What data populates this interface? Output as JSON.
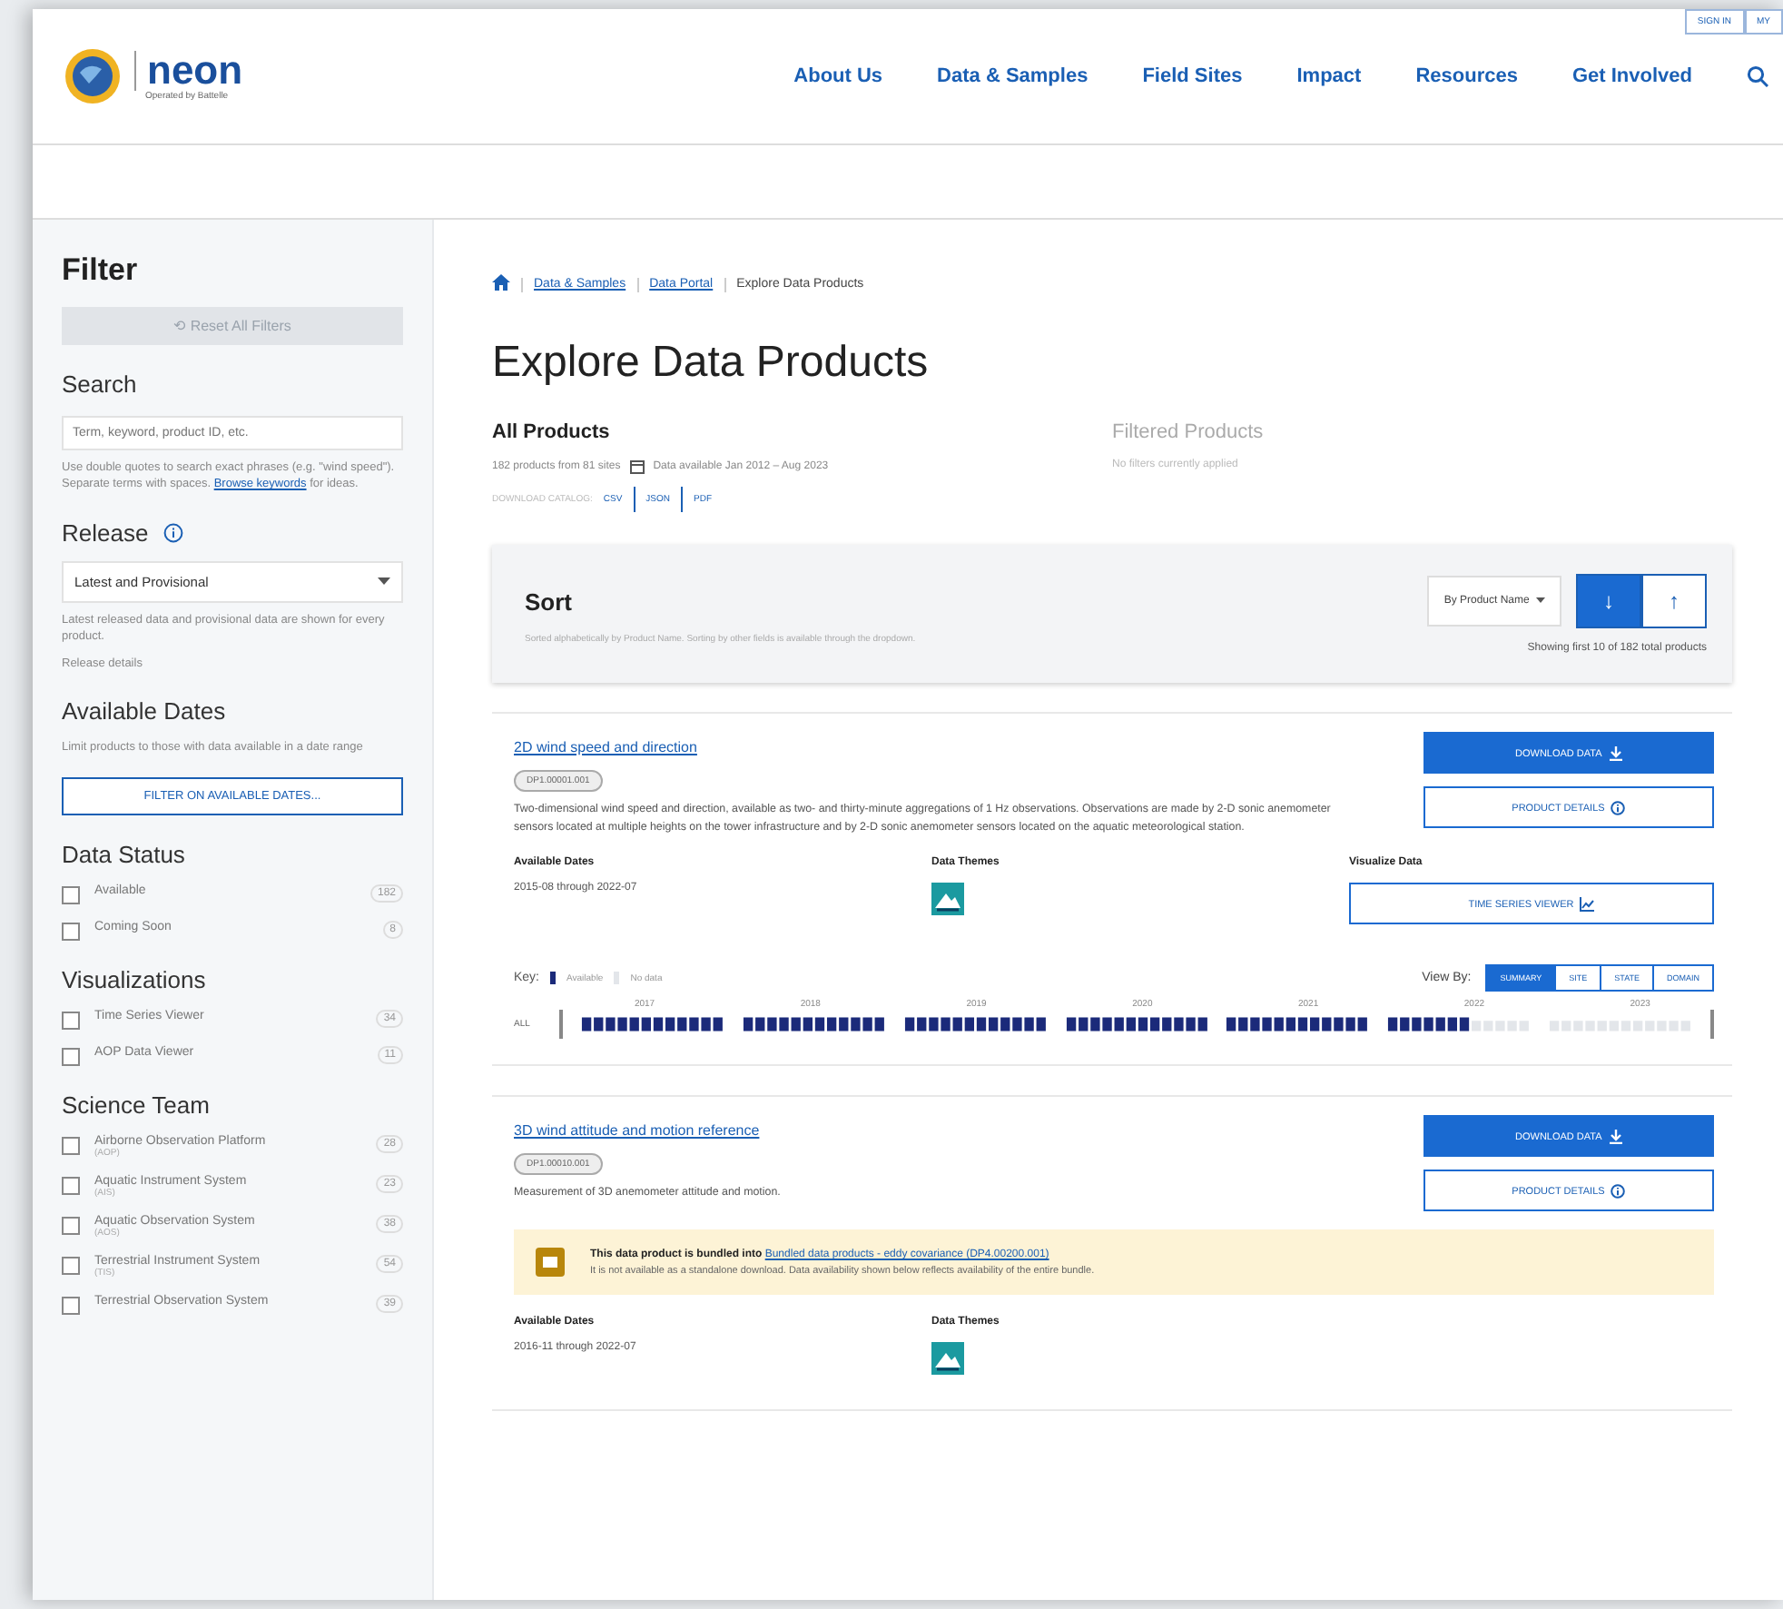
{
  "header": {
    "logo_text": "neon",
    "logo_subtitle": "Operated by Battelle",
    "nav": [
      "About Us",
      "Data & Samples",
      "Field Sites",
      "Impact",
      "Resources",
      "Get Involved"
    ],
    "top_links": [
      "SIGN IN",
      "MY"
    ]
  },
  "sidebar": {
    "title": "Filter",
    "reset_button": "⟲ Reset All Filters",
    "search": {
      "title": "Search",
      "placeholder": "Term, keyword, product ID, etc.",
      "help": "Use double quotes to search exact phrases (e.g. \"wind speed\"). Separate terms with spaces.",
      "help_link": "Browse keywords",
      "help_end": "for ideas."
    },
    "release": {
      "title": "Release",
      "value": "Latest and Provisional",
      "help": "Latest released data and provisional data are shown for every product.",
      "link": "Release details"
    },
    "dates": {
      "title": "Available Dates",
      "help": "Limit products to those with data available in a date range",
      "button": "FILTER ON AVAILABLE DATES..."
    },
    "groups": [
      {
        "title": "Data Status",
        "items": [
          {
            "label": "Available",
            "count": "182",
            "checked": false
          },
          {
            "label": "Coming Soon",
            "count": "8",
            "checked": false
          }
        ]
      },
      {
        "title": "Visualizations",
        "items": [
          {
            "label": "Time Series Viewer",
            "count": "34",
            "checked": false
          },
          {
            "label": "AOP Data Viewer",
            "count": "11",
            "checked": false
          }
        ]
      },
      {
        "title": "Science Team",
        "items": [
          {
            "label": "Airborne Observation Platform",
            "sub": "(AOP)",
            "count": "28",
            "checked": false
          },
          {
            "label": "Aquatic Instrument System",
            "sub": "(AIS)",
            "count": "23",
            "checked": false
          },
          {
            "label": "Aquatic Observation System",
            "sub": "(AOS)",
            "count": "38",
            "checked": false
          },
          {
            "label": "Terrestrial Instrument System",
            "sub": "(TIS)",
            "count": "54",
            "checked": false
          },
          {
            "label": "Terrestrial Observation System",
            "count": "39",
            "checked": false
          }
        ]
      }
    ]
  },
  "breadcrumb": [
    {
      "label": "Data & Samples",
      "kind": "link"
    },
    {
      "label": "Data Portal",
      "kind": "link"
    },
    {
      "label": "Explore Data Products",
      "kind": "current"
    }
  ],
  "title": "Explore Data Products",
  "all_products": {
    "title": "All Products",
    "count": "182 products from 81 sites",
    "dates": "Data available Jan 2012 – Aug 2023",
    "catalog_label": "DOWNLOAD CATALOG:",
    "formats": [
      "CSV",
      "JSON",
      "PDF"
    ]
  },
  "filtered_products": {
    "title": "Filtered Products",
    "note": "No filters currently applied"
  },
  "sort": {
    "title": "Sort",
    "note": "Sorted alphabetically by Product Name. Sorting by other fields is available through the dropdown.",
    "dropdown": "By Product Name",
    "directions": [
      {
        "label": "↓",
        "selected": true
      },
      {
        "label": "↑",
        "selected": false
      }
    ],
    "showing": "Showing first 10 of 182 total products"
  },
  "products": [
    {
      "name": "2D wind speed and direction",
      "code": "DP1.00001.001",
      "description": "Two-dimensional wind speed and direction, available as two- and thirty-minute aggregations of 1 Hz observations. Observations are made by 2-D sonic anemometer sensors located at multiple heights on the tower infrastructure and by 2-D sonic anemometer sensors located on the aquatic meteorological station.",
      "download": "DOWNLOAD DATA",
      "details": "PRODUCT DETAILS",
      "dates_label": "Available Dates",
      "dates": "2015-08 through 2022-07",
      "themes_label": "Data Themes",
      "visualize_label": "Visualize Data",
      "visualize_button": "TIME SERIES VIEWER",
      "availability": {
        "key_label": "Key:",
        "key_items": [
          {
            "label": "Available",
            "kind": "full"
          },
          {
            "label": "No data",
            "kind": "none"
          }
        ],
        "view_label": "View By:",
        "views": [
          {
            "label": "SUMMARY",
            "selected": true
          },
          {
            "label": "SITE",
            "selected": false
          },
          {
            "label": "STATE",
            "selected": false
          },
          {
            "label": "DOMAIN",
            "selected": false
          }
        ],
        "row_label": "ALL",
        "years": [
          {
            "label": "2017",
            "kind": "full"
          },
          {
            "label": "2018",
            "kind": "full"
          },
          {
            "label": "2019",
            "kind": "full"
          },
          {
            "label": "2020",
            "kind": "full"
          },
          {
            "label": "2021",
            "kind": "full"
          },
          {
            "label": "2022",
            "kind": "partial"
          },
          {
            "label": "2023",
            "kind": "none"
          }
        ]
      }
    },
    {
      "name": "3D wind attitude and motion reference",
      "code": "DP1.00010.001",
      "description": "Measurement of 3D anemometer attitude and motion.",
      "download": "DOWNLOAD DATA",
      "details": "PRODUCT DETAILS",
      "bundle": {
        "text": "This data product is bundled into",
        "link": "Bundled data products - eddy covariance (DP4.00200.001)",
        "note": "It is not available as a standalone download. Data availability shown below reflects availability of the entire bundle."
      },
      "dates_label": "Available Dates",
      "dates": "2016-11 through 2022-07",
      "themes_label": "Data Themes"
    }
  ]
}
